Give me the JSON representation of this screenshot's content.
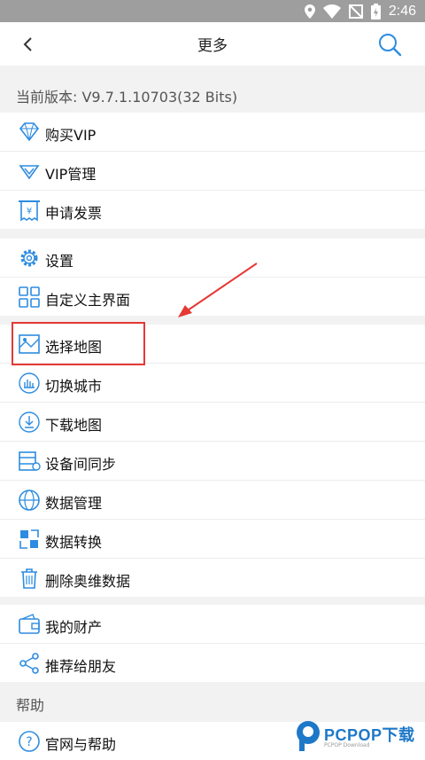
{
  "status_bar": {
    "time": "2:46",
    "icons": [
      "location-icon",
      "wifi-icon",
      "no-sim-icon",
      "battery-icon"
    ]
  },
  "topbar": {
    "title": "更多",
    "back_icon": "chevron-left-icon",
    "search_icon": "search-icon"
  },
  "version": {
    "text": "当前版本: V9.7.1.10703(32 Bits)"
  },
  "groups": [
    {
      "items": [
        {
          "label": "购买VIP",
          "icon": "diamond-icon"
        },
        {
          "label": "VIP管理",
          "icon": "vip-shield-icon"
        },
        {
          "label": "申请发票",
          "icon": "invoice-icon"
        }
      ]
    },
    {
      "items": [
        {
          "label": "设置",
          "icon": "gear-icon"
        },
        {
          "label": "自定义主界面",
          "icon": "grid-icon"
        }
      ]
    },
    {
      "items": [
        {
          "label": "选择地图",
          "icon": "map-icon"
        },
        {
          "label": "切换城市",
          "icon": "city-icon"
        },
        {
          "label": "下载地图",
          "icon": "download-icon"
        },
        {
          "label": "设备间同步",
          "icon": "sync-icon"
        },
        {
          "label": "数据管理",
          "icon": "globe-icon"
        },
        {
          "label": "数据转换",
          "icon": "convert-icon"
        },
        {
          "label": "删除奥维数据",
          "icon": "trash-icon"
        }
      ]
    },
    {
      "items": [
        {
          "label": "我的财产",
          "icon": "wallet-icon"
        },
        {
          "label": "推荐给朋友",
          "icon": "share-icon"
        }
      ]
    }
  ],
  "help": {
    "header": "帮助",
    "items": [
      {
        "label": "官网与帮助",
        "icon": "help-icon"
      }
    ]
  },
  "watermark": {
    "brand": "PCPOP下载",
    "sub": "PCPOP Download"
  },
  "colors": {
    "accent": "#2d8ce0",
    "highlight": "#e53935",
    "status_bar": "#9e9e9e"
  }
}
